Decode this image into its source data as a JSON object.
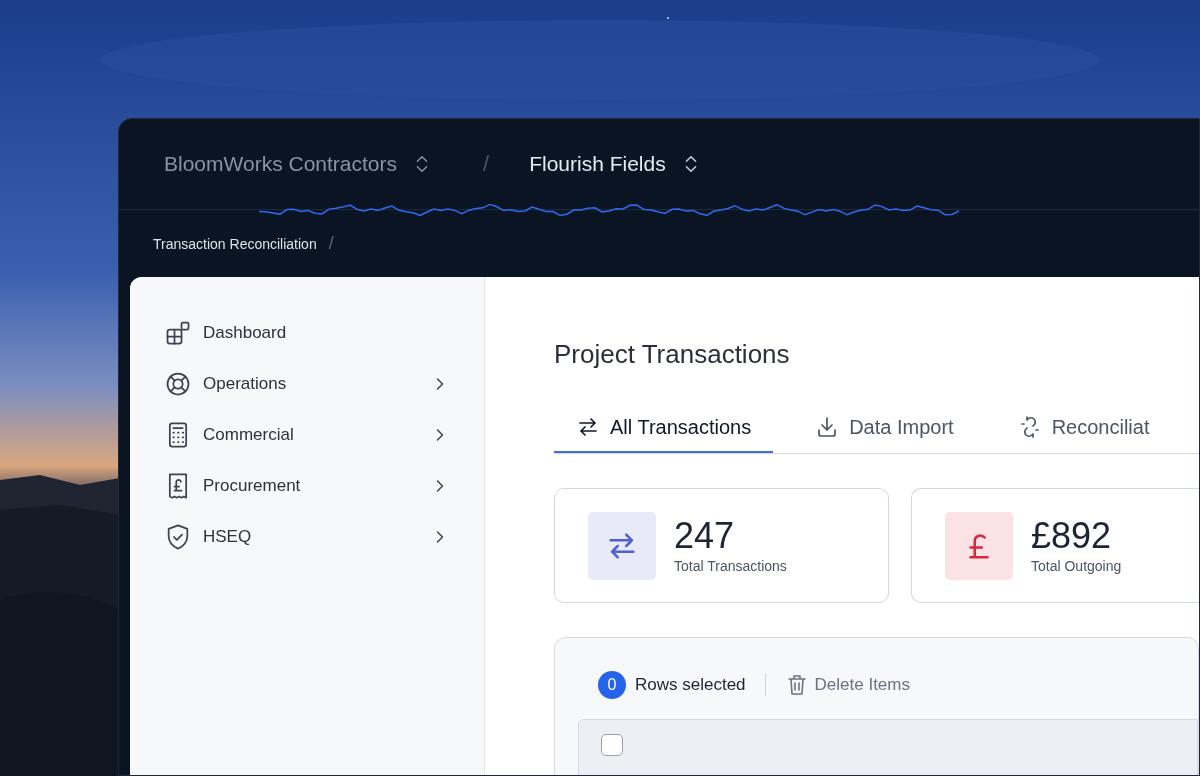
{
  "header": {
    "breadcrumbs": [
      {
        "label": "BloomWorks Contractors",
        "selected": false
      },
      {
        "label": "Flourish Fields",
        "selected": true
      }
    ],
    "separator": "/"
  },
  "sub_breadcrumb": {
    "label": "Transaction Reconciliation",
    "separator": "/"
  },
  "sidebar": {
    "items": [
      {
        "label": "Dashboard",
        "kind": "dashboard",
        "expandable": false
      },
      {
        "label": "Operations",
        "kind": "lifebuoy",
        "expandable": true
      },
      {
        "label": "Commercial",
        "kind": "calculator",
        "expandable": true
      },
      {
        "label": "Procurement",
        "kind": "receipt",
        "expandable": true
      },
      {
        "label": "HSEQ",
        "kind": "shield",
        "expandable": true
      }
    ]
  },
  "page_title": "Project Transactions",
  "tabs": [
    {
      "label": "All Transactions",
      "kind": "arrows",
      "selected": true
    },
    {
      "label": "Data Import",
      "kind": "download",
      "selected": false
    },
    {
      "label": "Reconciliat",
      "kind": "unlink",
      "selected": false
    }
  ],
  "stats": [
    {
      "value": "247",
      "label": "Total Transactions",
      "kind": "arrows",
      "color": "#4f5fd8"
    },
    {
      "value": "£892",
      "label": "Total Outgoing",
      "kind": "pound",
      "color": "#d6293e"
    }
  ],
  "table": {
    "selected_count": "0",
    "selected_label": "Rows selected",
    "delete_button": {
      "label": "Delete Items",
      "disabled": true
    },
    "header_checkbox": {
      "checked": false
    }
  }
}
